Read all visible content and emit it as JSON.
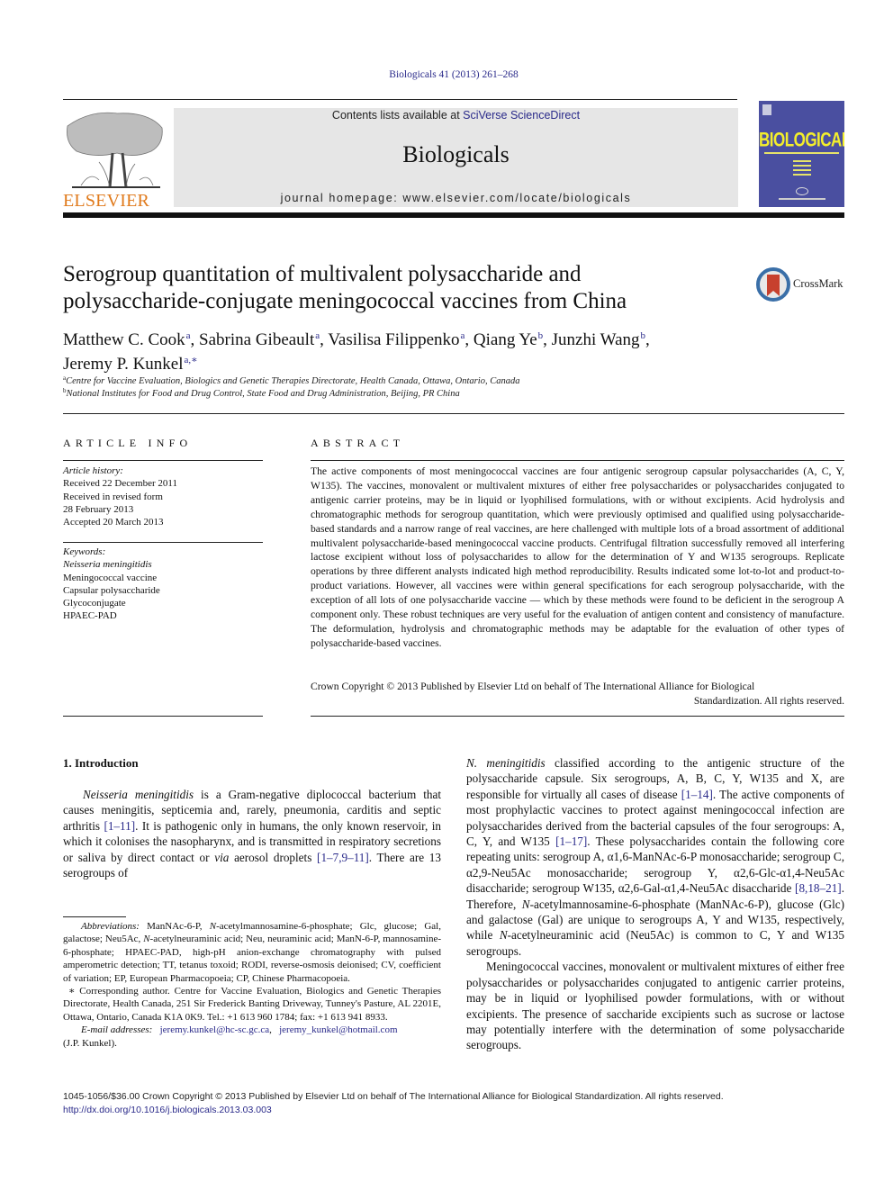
{
  "header": {
    "citation": "Biologicals 41 (2013) 261–268",
    "publisher_logo_text": "ELSEVIER",
    "contents_prefix": "Contents lists available at ",
    "contents_link": "SciVerse ScienceDirect",
    "journal_name": "Biologicals",
    "homepage": "journal homepage: www.elsevier.com/locate/biologicals",
    "cover_title": "BIOLOGICALS",
    "crossmark_label": "CrossMark",
    "colors": {
      "elsevier_orange": "#e07a1c",
      "link_blue": "#2a2a8a",
      "cover_blue": "#4a4fa0",
      "cover_yellow": "#f3ee2c",
      "header_gray": "#e6e6e6"
    }
  },
  "article": {
    "title_line1": "Serogroup quantitation of multivalent polysaccharide and",
    "title_line2": "polysaccharide-conjugate meningococcal vaccines from China",
    "authors": [
      {
        "name": "Matthew C. Cook",
        "aff": "a",
        "sep": ", "
      },
      {
        "name": "Sabrina Gibeault",
        "aff": "a",
        "sep": ", "
      },
      {
        "name": "Vasilisa Filippenko",
        "aff": "a",
        "sep": ", "
      },
      {
        "name": "Qiang Ye",
        "aff": "b",
        "sep": ", "
      },
      {
        "name": "Junzhi Wang",
        "aff": "b",
        "sep": ","
      },
      {
        "name": "Jeremy P. Kunkel",
        "aff": "a,∗",
        "sep": ""
      }
    ],
    "affiliations": [
      {
        "mark": "a",
        "text": "Centre for Vaccine Evaluation, Biologics and Genetic Therapies Directorate, Health Canada, Ottawa, Ontario, Canada"
      },
      {
        "mark": "b",
        "text": "National Institutes for Food and Drug Control, State Food and Drug Administration, Beijing, PR China"
      }
    ]
  },
  "article_info": {
    "heading": "ARTICLE INFO",
    "history_label": "Article history:",
    "history": [
      "Received 22 December 2011",
      "Received in revised form",
      "28 February 2013",
      "Accepted 20 March 2013"
    ],
    "keywords_label": "Keywords:",
    "keywords": [
      "Neisseria meningitidis",
      "Meningococcal vaccine",
      "Capsular polysaccharide",
      "Glycoconjugate",
      "HPAEC-PAD"
    ]
  },
  "abstract": {
    "heading": "ABSTRACT",
    "text": "The active components of most meningococcal vaccines are four antigenic serogroup capsular poly­saccharides (A, C, Y, W135). The vaccines, monovalent or multivalent mixtures of either free poly­saccharides or polysaccharides conjugated to antigenic carrier proteins, may be in liquid or lyophilised formulations, with or without excipients. Acid hydrolysis and chromatographic methods for serogroup quantitation, which were previously optimised and qualified using polysaccharide-based standards and a narrow range of real vaccines, are here challenged with multiple lots of a broad assortment of additional multivalent polysaccharide-based meningococcal vaccine products. Centrifugal filtration successfully removed all interfering lactose excipient without loss of polysaccharides to allow for the determination of Y and W135 serogroups. Replicate operations by three different analysts indicated high method reproducibility. Results indicated some lot-to-lot and product-to-product variations. However, all vac­cines were within general specifications for each serogroup polysaccharide, with the exception of all lots of one polysaccharide vaccine — which by these methods were found to be deficient in the serogroup A component only. These robust techniques are very useful for the evaluation of antigen content and consistency of manufacture. The deformulation, hydrolysis and chromatographic methods may be adaptable for the evaluation of other types of polysaccharide-based vaccines.",
    "copyright_line1": "Crown Copyright © 2013 Published by Elsevier Ltd on behalf of The International Alliance for Biological",
    "copyright_line2": "Standardization. All rights reserved."
  },
  "introduction": {
    "heading": "1.  Introduction",
    "left_para": {
      "species": "Neisseria meningitidis",
      "t1": " is a Gram-negative diplococcal bacterium that causes meningitis, septicemia and, rarely, pneumonia, carditis and septic arthritis ",
      "ref1": "[1–11]",
      "t2": ". It is pathogenic only in humans, the only known reservoir, in which it colonises the nasopharynx, and is transmitted in respiratory secretions or saliva by direct contact or ",
      "via": "via",
      "t3": " aerosol droplets ",
      "ref2": "[1–7,9–11]",
      "t4": ". There are 13 serogroups of"
    },
    "right_para1": {
      "species": "N. meningitidis",
      "t1": " classified according to the antigenic structure of the polysaccharide capsule. Six serogroups, A, B, C, Y, W135 and X, are responsible for virtually all cases of disease ",
      "ref1": "[1–14]",
      "t2": ". The active components of most prophylactic vaccines to protect against meningococcal infection are polysaccharides derived from the bacterial capsules of the four serogroups: A, C, Y, and W135 ",
      "ref2": "[1–17]",
      "t3": ". These polysaccharides contain the following core repeating units: serogroup A, α1,6-ManNAc-6-P monosaccharide; serogroup C, α2,9-Neu5Ac monosaccharide; serogroup Y, α2,6-Glc-α1,4-Neu5Ac disaccharide; serogroup W135, α2,6-Gal-α1,4-Neu5Ac disaccharide ",
      "ref3": "[8,18–21]",
      "t4": ". Therefore, ",
      "n1": "N",
      "t5": "-acetylmannosamine-6-phosphate (Man­NAc-6-P), glucose (Glc) and galactose (Gal) are unique to serogroups A, Y and W135, respectively, while ",
      "n2": "N",
      "t6": "-acetylneuraminic acid (Neu5Ac) is common to C, Y and W135 serogroups."
    },
    "right_para2": "Meningococcal vaccines, monovalent or multivalent mixtures of either free polysaccharides or polysaccharides conjugated to anti­genic carrier proteins, may be in liquid or lyophilised powder for­mulations, with or without excipients. The presence of saccharide excipients such as sucrose or lactose may potentially interfere with the determination of some polysaccharide serogroups."
  },
  "footnotes": {
    "abbrev_label": "Abbreviations:",
    "abbrev_text_a": " ManNAc-6-P, ",
    "abbrev_n1": "N",
    "abbrev_text_b": "-acetylmannosamine-6-phosphate; Glc, glucose; Gal, galactose; Neu5Ac, ",
    "abbrev_n2": "N",
    "abbrev_text_c": "-acetylneuraminic acid; Neu, neuraminic acid; ManN-6-P, mannosamine-6-phosphate; HPAEC-PAD, high-pH anion-exchange chromatog­raphy with pulsed amperometric detection; TT, tetanus toxoid; RODI, reverse-osmosis deionised; CV, coefficient of variation; EP, European Pharmacopoeia; CP, Chinese Pharmacopoeia.",
    "corresponding": "∗ Corresponding author. Centre for Vaccine Evaluation, Biologics and Genetic Therapies Directorate, Health Canada, 251 Sir Frederick Banting Driveway, Tunney's Pasture, AL 2201E, Ottawa, Ontario, Canada K1A 0K9. Tel.: +1 613 960 1784; fax: +1 613 941 8933.",
    "email_label": "E-mail addresses:",
    "email1": "jeremy.kunkel@hc-sc.gc.ca",
    "email_sep": ", ",
    "email2": "jeremy_kunkel@hotmail.com",
    "email_owner": "(J.P. Kunkel)."
  },
  "bottom": {
    "issn_copyright": "1045-1056/$36.00 Crown Copyright © 2013 Published by Elsevier Ltd on behalf of The International Alliance for Biological Standardization. All rights reserved.",
    "doi": "http://dx.doi.org/10.1016/j.biologicals.2013.03.003"
  }
}
